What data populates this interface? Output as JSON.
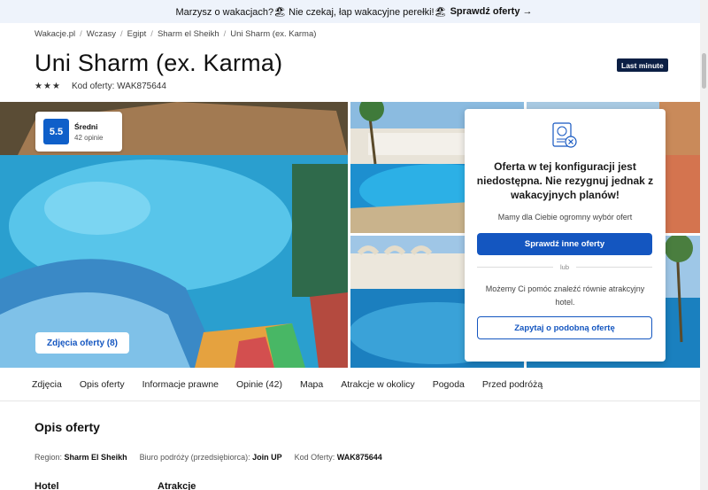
{
  "promo": {
    "text": "Marzysz o wakacjach?🏖 Nie czekaj, łap wakacyjne perełki!🏖",
    "link": "Sprawdź oferty →"
  },
  "breadcrumb": [
    "Wakacje.pl",
    "Wczasy",
    "Egipt",
    "Sharm el Sheikh",
    "Uni Sharm (ex. Karma)"
  ],
  "hotel": {
    "name": "Uni Sharm (ex. Karma)",
    "badge": "Last minute",
    "stars": 3,
    "code_label": "Kod oferty: WAK875644"
  },
  "rating": {
    "score": "5.5",
    "label": "Średni",
    "count": "42 opinie"
  },
  "photos_button": "Zdjęcia oferty (8)",
  "offer_card": {
    "title": "Oferta w tej konfiguracji jest niedostępna. Nie rezygnuj jednak z wakacyjnych planów!",
    "subtitle": "Mamy dla Ciebie ogromny wybór ofert",
    "primary_button": "Sprawdź inne oferty",
    "divider": "lub",
    "help_text": "Możemy Ci pomóc znaleźć równie atrakcyjny hotel.",
    "secondary_button": "Zapytaj o podobną ofertę"
  },
  "tabs": [
    "Zdjęcia",
    "Opis oferty",
    "Informacje prawne",
    "Opinie (42)",
    "Mapa",
    "Atrakcje w okolicy",
    "Pogoda",
    "Przed podróżą"
  ],
  "section": {
    "title": "Opis oferty",
    "region_label": "Region:",
    "region_value": "Sharm El Sheikh",
    "agency_label": "Biuro podróży (przedsiębiorca):",
    "agency_value": "Join UP",
    "code_label": "Kod Oferty:",
    "code_value": "WAK875644",
    "col1": "Hotel",
    "col2": "Atrakcje"
  },
  "colors": {
    "accent": "#1456c0",
    "badge_bg": "#0b1f44",
    "promo_bg": "#eef3fb"
  }
}
